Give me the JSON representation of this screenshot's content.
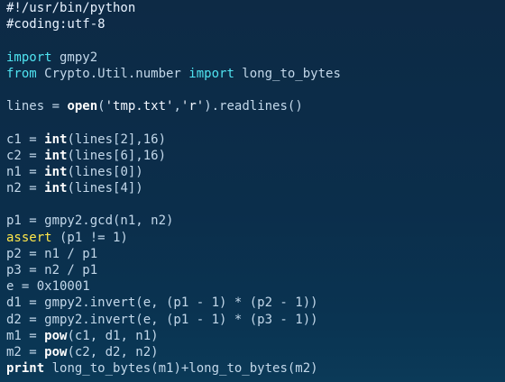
{
  "editor": {
    "lines": [
      [
        {
          "t": "#!/usr/bin/python",
          "k": "comment"
        }
      ],
      [
        {
          "t": "#coding:utf-8",
          "k": "comment"
        }
      ],
      [],
      [
        {
          "t": "import",
          "k": "kw"
        },
        {
          "t": " gmpy2",
          "k": "plain"
        }
      ],
      [
        {
          "t": "from",
          "k": "kw"
        },
        {
          "t": " Crypto.Util.number ",
          "k": "plain"
        },
        {
          "t": "import",
          "k": "kw"
        },
        {
          "t": " long_to_bytes",
          "k": "plain"
        }
      ],
      [],
      [
        {
          "t": "lines = ",
          "k": "plain"
        },
        {
          "t": "open",
          "k": "builtin"
        },
        {
          "t": "(",
          "k": "plain"
        },
        {
          "t": "'tmp.txt'",
          "k": "str"
        },
        {
          "t": ",",
          "k": "plain"
        },
        {
          "t": "'r'",
          "k": "str"
        },
        {
          "t": ").readlines()",
          "k": "plain"
        }
      ],
      [],
      [
        {
          "t": "c1 = ",
          "k": "plain"
        },
        {
          "t": "int",
          "k": "builtin"
        },
        {
          "t": "(lines[2],16)",
          "k": "plain"
        }
      ],
      [
        {
          "t": "c2 = ",
          "k": "plain"
        },
        {
          "t": "int",
          "k": "builtin"
        },
        {
          "t": "(lines[6],16)",
          "k": "plain"
        }
      ],
      [
        {
          "t": "n1 = ",
          "k": "plain"
        },
        {
          "t": "int",
          "k": "builtin"
        },
        {
          "t": "(lines[0])",
          "k": "plain"
        }
      ],
      [
        {
          "t": "n2 = ",
          "k": "plain"
        },
        {
          "t": "int",
          "k": "builtin"
        },
        {
          "t": "(lines[4])",
          "k": "plain"
        }
      ],
      [],
      [
        {
          "t": "p1 = gmpy2.gcd(n1, n2)",
          "k": "plain"
        }
      ],
      [
        {
          "t": "assert",
          "k": "assert"
        },
        {
          "t": " (p1 != 1)",
          "k": "plain"
        }
      ],
      [
        {
          "t": "p2 = n1 / p1",
          "k": "plain"
        }
      ],
      [
        {
          "t": "p3 = n2 / p1",
          "k": "plain"
        }
      ],
      [
        {
          "t": "e = 0x10001",
          "k": "plain"
        }
      ],
      [
        {
          "t": "d1 = gmpy2.invert(e, (p1 - 1) * (p2 - 1))",
          "k": "plain"
        }
      ],
      [
        {
          "t": "d2 = gmpy2.invert(e, (p1 - 1) * (p3 - 1))",
          "k": "plain"
        }
      ],
      [
        {
          "t": "m1 = ",
          "k": "plain"
        },
        {
          "t": "pow",
          "k": "builtin"
        },
        {
          "t": "(c1, d1, n1)",
          "k": "plain"
        }
      ],
      [
        {
          "t": "m2 = ",
          "k": "plain"
        },
        {
          "t": "pow",
          "k": "builtin"
        },
        {
          "t": "(c2, d2, n2)",
          "k": "plain"
        }
      ],
      [
        {
          "t": "print",
          "k": "print"
        },
        {
          "t": " long_to_bytes(m1)+long_to_bytes(m2)",
          "k": "plain"
        }
      ]
    ]
  },
  "colors": {
    "background_top": "#0d2a45",
    "background_bottom": "#0b3a58",
    "keyword": "#4fe3f0",
    "builtin": "#ffffff",
    "assert": "#ffe74a",
    "plain": "#c3d8ea"
  }
}
